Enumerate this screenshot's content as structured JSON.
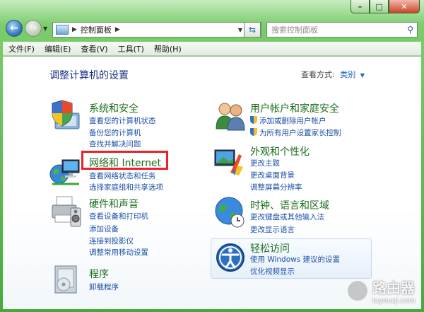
{
  "window": {
    "caption_buttons": {
      "minimize": "–",
      "maximize": "□",
      "close": "✕"
    }
  },
  "nav": {
    "breadcrumb": "控制面板",
    "search_placeholder": "搜索控制面板"
  },
  "menu": [
    "文件(F)",
    "编辑(E)",
    "查看(V)",
    "工具(T)",
    "帮助(H)"
  ],
  "page": {
    "title": "调整计算机的设置",
    "viewby_label": "查看方式:",
    "viewby_value": "类别"
  },
  "categories": {
    "system_security": {
      "title": "系统和安全",
      "links": [
        "查看您的计算机状态",
        "备份您的计算机",
        "查找并解决问题"
      ]
    },
    "network": {
      "title": "网络和 Internet",
      "links": [
        "查看网络状态和任务",
        "选择家庭组和共享选项"
      ]
    },
    "hardware": {
      "title": "硬件和声音",
      "links": [
        "查看设备和打印机",
        "添加设备",
        "连接到投影仪",
        "调整常用移动设置"
      ]
    },
    "programs": {
      "title": "程序",
      "links": [
        "卸载程序"
      ]
    },
    "users": {
      "title": "用户帐户和家庭安全",
      "links": [
        "添加或删除用户帐户",
        "为所有用户设置家长控制"
      ]
    },
    "appearance": {
      "title": "外观和个性化",
      "links": [
        "更改主题",
        "更改桌面背景",
        "调整屏幕分辨率"
      ]
    },
    "clock": {
      "title": "时钟、语言和区域",
      "links": [
        "更改键盘或其他输入法",
        "更改显示语言"
      ]
    },
    "ease": {
      "title": "轻松访问",
      "links": [
        "使用 Windows 建议的设置",
        "优化视频显示"
      ]
    }
  },
  "watermark": {
    "cn": "路由器",
    "en": "luyouqi.com"
  },
  "colors": {
    "highlight": "#e8232a",
    "link": "#1e50a8",
    "category_title": "#1b6d1b",
    "frame": "#48a93a"
  }
}
